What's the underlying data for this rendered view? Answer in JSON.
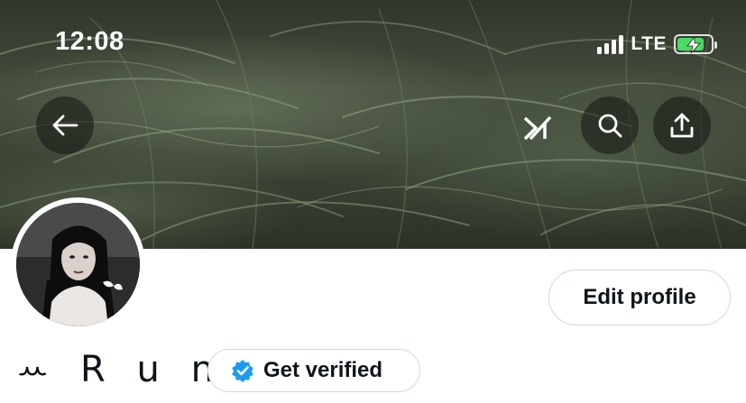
{
  "status_bar": {
    "time": "12:08",
    "network": "LTE",
    "battery_level": 0.8,
    "battery_charging": true,
    "battery_color": "#4cd964"
  },
  "header": {
    "back_icon": "arrow-left-icon",
    "grok_icon": "grok-icon",
    "search_icon": "search-icon",
    "share_icon": "share-icon"
  },
  "profile": {
    "display_name": "ꕀ R u n a ,",
    "edit_label": "Edit profile",
    "verify_label": "Get verified",
    "verified_badge_color": "#1d9bf0"
  }
}
